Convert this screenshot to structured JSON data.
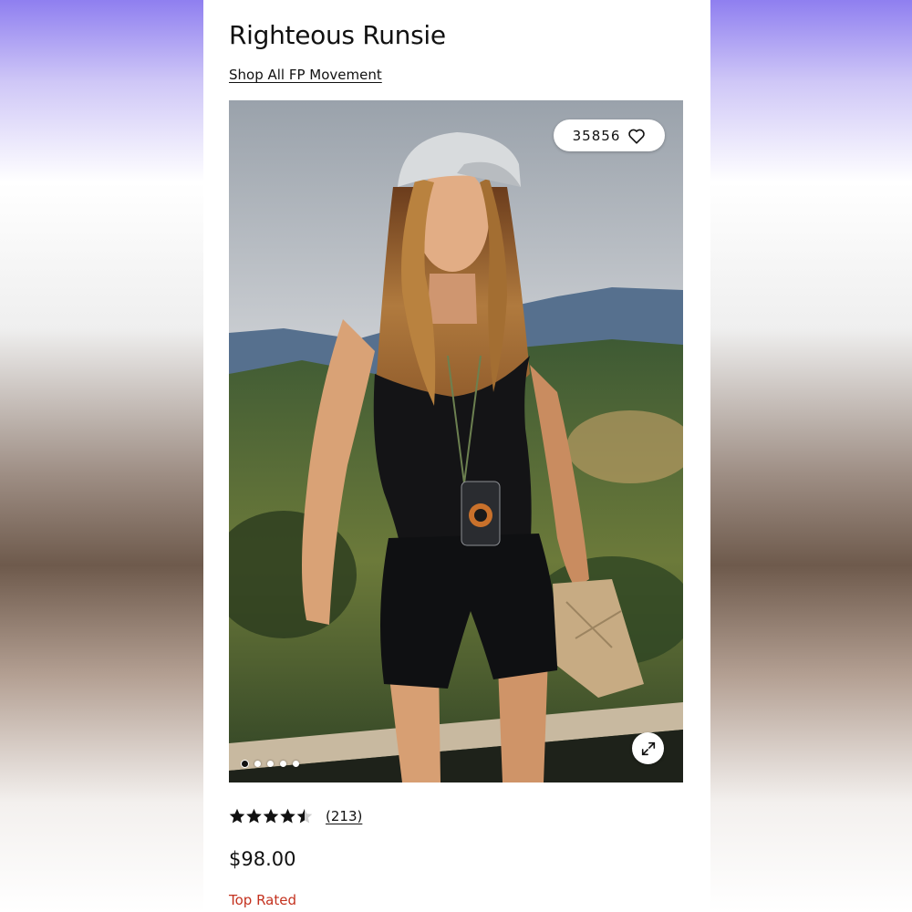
{
  "product": {
    "title": "Righteous Runsie",
    "shop_link": "Shop All FP Movement",
    "like_count": "35856",
    "rating": 4.5,
    "review_count": "(213)",
    "price": "$98.00",
    "badge": "Top Rated"
  },
  "carousel": {
    "total": 5,
    "active": 0
  },
  "icons": {
    "like": "heart-icon",
    "expand": "expand-icon",
    "star": "star-icon"
  },
  "colors": {
    "badge": "#c4321f",
    "text": "#111111",
    "page": "#ffffff"
  }
}
